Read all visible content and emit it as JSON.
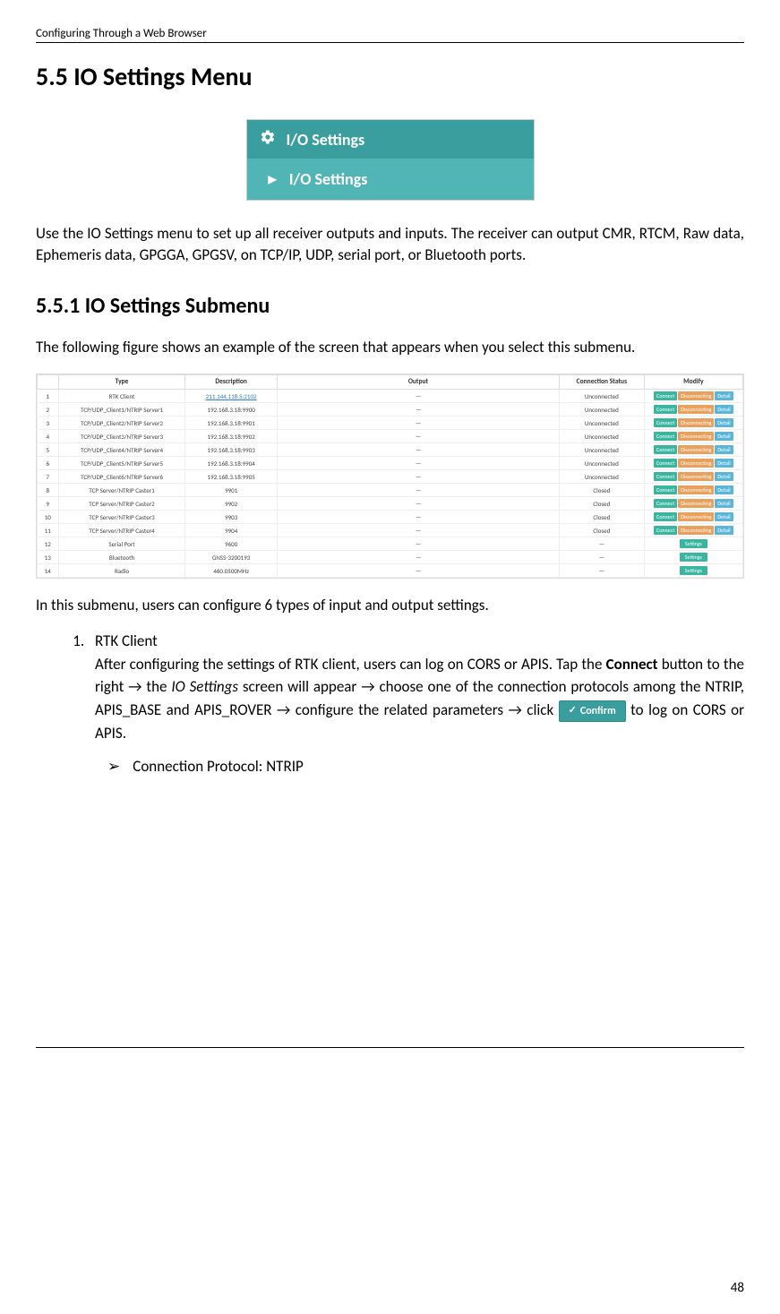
{
  "header": {
    "section_title": "Configuring Through a Web Browser"
  },
  "h1": "5.5 IO Settings Menu",
  "nav_box": {
    "header_label": "I/O Settings",
    "sub_label": "I/O Settings"
  },
  "intro_paragraph": "Use the IO Settings menu to set up all receiver outputs and inputs. The receiver can output CMR, RTCM, Raw data, Ephemeris data, GPGGA, GPGSV, on TCP/IP, UDP, serial port, or Bluetooth ports.",
  "h2": "5.5.1 IO Settings Submenu",
  "subintro_paragraph": "The following figure shows an example of the screen that appears when you select this submenu.",
  "table": {
    "headers": [
      "",
      "Type",
      "Description",
      "Output",
      "Connection Status",
      "Modify"
    ],
    "btn_labels": {
      "connect": "Connect",
      "disconnecting": "Disconnecting",
      "detail": "Detail",
      "settings": "Settings"
    },
    "rows": [
      {
        "n": "1",
        "type": "RTK Client",
        "desc": "211.144.118.5:2102",
        "desc_link": true,
        "output": "—",
        "status": "Unconnected",
        "modify": "triple"
      },
      {
        "n": "2",
        "type": "TCP/UDP_Client1/NTRIP Server1",
        "desc": "192.168.3.18:9900",
        "output": "—",
        "status": "Unconnected",
        "modify": "triple"
      },
      {
        "n": "3",
        "type": "TCP/UDP_Client2/NTRIP Server2",
        "desc": "192.168.3.18:9901",
        "output": "—",
        "status": "Unconnected",
        "modify": "triple"
      },
      {
        "n": "4",
        "type": "TCP/UDP_Client3/NTRIP Server3",
        "desc": "192.168.3.18:9902",
        "output": "—",
        "status": "Unconnected",
        "modify": "triple"
      },
      {
        "n": "5",
        "type": "TCP/UDP_Client4/NTRIP Server4",
        "desc": "192.168.3.18:9903",
        "output": "—",
        "status": "Unconnected",
        "modify": "triple"
      },
      {
        "n": "6",
        "type": "TCP/UDP_Client5/NTRIP Server5",
        "desc": "192.168.3.18:9904",
        "output": "—",
        "status": "Unconnected",
        "modify": "triple"
      },
      {
        "n": "7",
        "type": "TCP/UDP_Client6/NTRIP Server6",
        "desc": "192.168.3.18:9905",
        "output": "—",
        "status": "Unconnected",
        "modify": "triple"
      },
      {
        "n": "8",
        "type": "TCP Server/NTRIP Caster1",
        "desc": "9901",
        "output": "—",
        "status": "Closed",
        "modify": "triple"
      },
      {
        "n": "9",
        "type": "TCP Server/NTRIP Caster2",
        "desc": "9902",
        "output": "—",
        "status": "Closed",
        "modify": "triple"
      },
      {
        "n": "10",
        "type": "TCP Server/NTRIP Caster3",
        "desc": "9903",
        "output": "—",
        "status": "Closed",
        "modify": "triple"
      },
      {
        "n": "11",
        "type": "TCP Server/NTRIP Caster4",
        "desc": "9904",
        "output": "—",
        "status": "Closed",
        "modify": "triple"
      },
      {
        "n": "12",
        "type": "Serial Port",
        "desc": "9600",
        "output": "—",
        "status": "—",
        "modify": "settings"
      },
      {
        "n": "13",
        "type": "Bluetooth",
        "desc": "GNSS-3200193",
        "output": "—",
        "status": "—",
        "modify": "settings"
      },
      {
        "n": "14",
        "type": "Radio",
        "desc": "460.0500MHz",
        "output": "—",
        "status": "—",
        "modify": "settings"
      }
    ]
  },
  "after_table_paragraph": "In this submenu, users can configure 6 types of input and output settings.",
  "list_item_title": "RTK Client",
  "list_item_body_1": "After configuring the settings of RTK client, users can log on CORS or APIS. Tap the ",
  "list_bold_1": "Connect",
  "list_item_body_2": " button to the right → the ",
  "list_italic_1": "IO Settings",
  "list_item_body_3": " screen will appear → choose one of the connection protocols among the NTRIP, APIS_BASE and APIS_ROVER → configure the related parameters → click ",
  "confirm_label": "Confirm",
  "list_item_body_4": " to log on CORS or APIS.",
  "sub_bullet_text": "Connection Protocol: NTRIP",
  "page_number": "48"
}
